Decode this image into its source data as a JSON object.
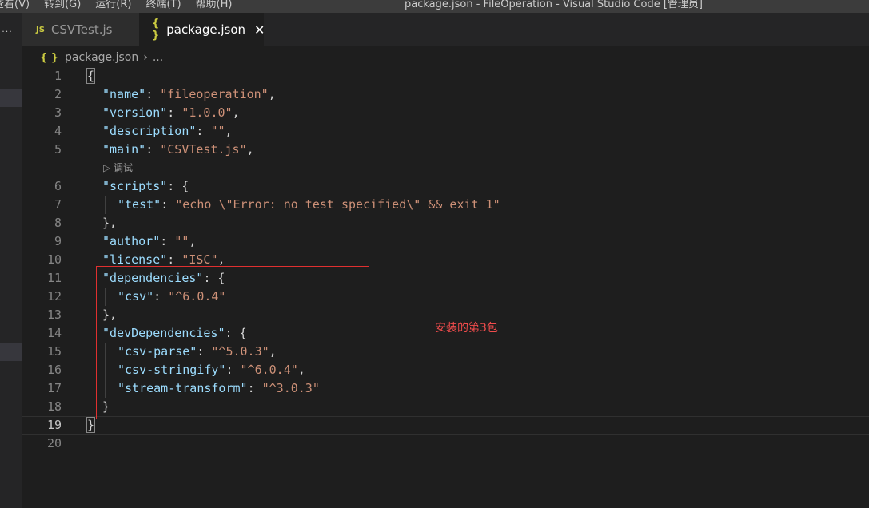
{
  "window": {
    "title": "package.json - FileOperation - Visual Studio Code [管理员]",
    "menu": [
      "查看(V)",
      "转到(G)",
      "运行(R)",
      "终端(T)",
      "帮助(H)"
    ]
  },
  "activity_bar": {
    "more_label": "..."
  },
  "tabs": [
    {
      "icon": "JS",
      "label": "CSVTest.js",
      "active": false
    },
    {
      "icon": "{ }",
      "label": "package.json",
      "active": true,
      "close": "✕"
    }
  ],
  "breadcrumb": {
    "icon": "{ }",
    "file": "package.json",
    "separator": "›",
    "more": "..."
  },
  "editor": {
    "codelens": "▷ 调试",
    "current_line": 19,
    "lines": [
      {
        "n": "1",
        "code": "{"
      },
      {
        "n": "2",
        "code": "\"name\": \"fileoperation\","
      },
      {
        "n": "3",
        "code": "\"version\": \"1.0.0\","
      },
      {
        "n": "4",
        "code": "\"description\": \"\","
      },
      {
        "n": "5",
        "code": "\"main\": \"CSVTest.js\","
      },
      {
        "n": "6",
        "code": "\"scripts\": {"
      },
      {
        "n": "7",
        "code": "\"test\": \"echo \\\"Error: no test specified\\\" && exit 1\""
      },
      {
        "n": "8",
        "code": "},"
      },
      {
        "n": "9",
        "code": "\"author\": \"\","
      },
      {
        "n": "10",
        "code": "\"license\": \"ISC\","
      },
      {
        "n": "11",
        "code": "\"dependencies\": {"
      },
      {
        "n": "12",
        "code": "\"csv\": \"^6.0.4\""
      },
      {
        "n": "13",
        "code": "},"
      },
      {
        "n": "14",
        "code": "\"devDependencies\": {"
      },
      {
        "n": "15",
        "code": "\"csv-parse\": \"^5.0.3\","
      },
      {
        "n": "16",
        "code": "\"csv-stringify\": \"^6.0.4\","
      },
      {
        "n": "17",
        "code": "\"stream-transform\": \"^3.0.3\""
      },
      {
        "n": "18",
        "code": "}"
      },
      {
        "n": "19",
        "code": "}"
      },
      {
        "n": "20",
        "code": ""
      }
    ]
  },
  "annotation": {
    "text": "安装的第3包",
    "color": "#f14c4c"
  },
  "colors": {
    "key": "#9cdcfe",
    "string": "#ce9178",
    "punct": "#d4d4d4",
    "accent_icon": "#cbcb41"
  }
}
